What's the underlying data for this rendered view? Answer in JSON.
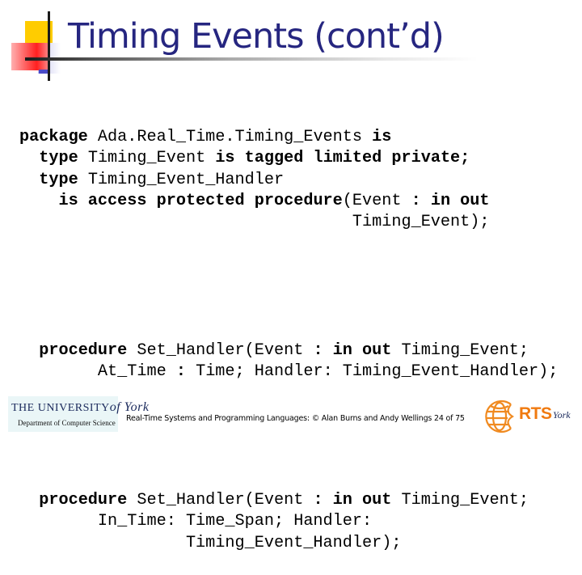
{
  "slide": {
    "title": "Timing Events (cont’d)",
    "code": {
      "block1": [
        [
          {
            "t": "package",
            "kw": true
          },
          {
            "t": " Ada.Real_Time.Timing_Events "
          },
          {
            "t": "is",
            "kw": true
          }
        ],
        [
          {
            "t": "  "
          },
          {
            "t": "type",
            "kw": true
          },
          {
            "t": " Timing_Event "
          },
          {
            "t": "is tagged limited private;",
            "kw": true
          }
        ],
        [
          {
            "t": "  "
          },
          {
            "t": "type",
            "kw": true
          },
          {
            "t": " Timing_Event_Handler"
          }
        ],
        [
          {
            "t": "    "
          },
          {
            "t": "is access protected procedure",
            "kw": true
          },
          {
            "t": "(Event "
          },
          {
            "t": ": in out",
            "kw": true
          }
        ],
        [
          {
            "t": "                                  Timing_Event);"
          }
        ]
      ],
      "block2": [
        [
          {
            "t": "  "
          },
          {
            "t": "procedure",
            "kw": true
          },
          {
            "t": " Set_Handler(Event "
          },
          {
            "t": ": in out",
            "kw": true
          },
          {
            "t": " Timing_Event;"
          }
        ],
        [
          {
            "t": "        At_Time "
          },
          {
            "t": ":",
            "kw": true
          },
          {
            "t": " Time; Handler: Timing_Event_Handler);"
          }
        ]
      ],
      "block3": [
        [
          {
            "t": "  "
          },
          {
            "t": "procedure",
            "kw": true
          },
          {
            "t": " Set_Handler(Event "
          },
          {
            "t": ": in out",
            "kw": true
          },
          {
            "t": " Timing_Event;"
          }
        ],
        [
          {
            "t": "        In_Time: Time_Span; Handler:"
          }
        ],
        [
          {
            "t": "                 Timing_Event_Handler);"
          }
        ]
      ]
    }
  },
  "footer": {
    "york_logo": {
      "line1": "THE UNIVERSITY",
      "line1_script": "of York",
      "line2": "Department of Computer Science",
      "background": "#eaf6f7"
    },
    "citation": "Real-Time Systems and Programming Languages: © Alan Burns and Andy Wellings 24 of 75",
    "rts_logo": {
      "text": "RTS",
      "script": "York",
      "color": "#f07a10"
    }
  },
  "colors": {
    "title": "#262680",
    "accent_yellow": "#ffcc00",
    "accent_red": "#ff2020",
    "accent_blue": "#4a4ac8"
  }
}
